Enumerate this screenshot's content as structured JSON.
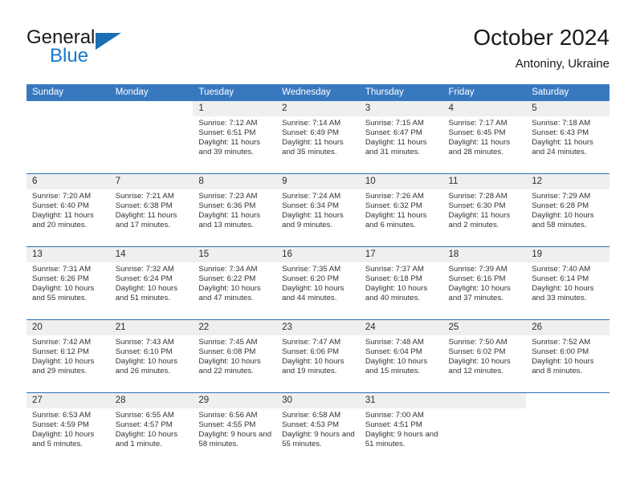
{
  "brand": {
    "name_line1": "General",
    "name_line2": "Blue",
    "triangle_icon": "triangle-icon",
    "color_dark": "#1a1a1a",
    "color_blue": "#1877c9"
  },
  "header": {
    "title": "October 2024",
    "subtitle": "Antoniny, Ukraine"
  },
  "theme": {
    "header_blue": "#3878bf",
    "divider_blue": "#2c6fb2",
    "daynum_band": "#efefef",
    "text": "#333333"
  },
  "weekdays": [
    "Sunday",
    "Monday",
    "Tuesday",
    "Wednesday",
    "Thursday",
    "Friday",
    "Saturday"
  ],
  "weeks": [
    {
      "days": [
        {
          "number": "",
          "detail": "",
          "empty": true
        },
        {
          "number": "",
          "detail": "",
          "empty": true
        },
        {
          "number": "1",
          "detail": "Sunrise: 7:12 AM\nSunset: 6:51 PM\nDaylight: 11 hours and 39 minutes."
        },
        {
          "number": "2",
          "detail": "Sunrise: 7:14 AM\nSunset: 6:49 PM\nDaylight: 11 hours and 35 minutes."
        },
        {
          "number": "3",
          "detail": "Sunrise: 7:15 AM\nSunset: 6:47 PM\nDaylight: 11 hours and 31 minutes."
        },
        {
          "number": "4",
          "detail": "Sunrise: 7:17 AM\nSunset: 6:45 PM\nDaylight: 11 hours and 28 minutes."
        },
        {
          "number": "5",
          "detail": "Sunrise: 7:18 AM\nSunset: 6:43 PM\nDaylight: 11 hours and 24 minutes."
        }
      ],
      "band_start_col": 2,
      "band_end_col": 7
    },
    {
      "days": [
        {
          "number": "6",
          "detail": "Sunrise: 7:20 AM\nSunset: 6:40 PM\nDaylight: 11 hours and 20 minutes."
        },
        {
          "number": "7",
          "detail": "Sunrise: 7:21 AM\nSunset: 6:38 PM\nDaylight: 11 hours and 17 minutes."
        },
        {
          "number": "8",
          "detail": "Sunrise: 7:23 AM\nSunset: 6:36 PM\nDaylight: 11 hours and 13 minutes."
        },
        {
          "number": "9",
          "detail": "Sunrise: 7:24 AM\nSunset: 6:34 PM\nDaylight: 11 hours and 9 minutes."
        },
        {
          "number": "10",
          "detail": "Sunrise: 7:26 AM\nSunset: 6:32 PM\nDaylight: 11 hours and 6 minutes."
        },
        {
          "number": "11",
          "detail": "Sunrise: 7:28 AM\nSunset: 6:30 PM\nDaylight: 11 hours and 2 minutes."
        },
        {
          "number": "12",
          "detail": "Sunrise: 7:29 AM\nSunset: 6:28 PM\nDaylight: 10 hours and 58 minutes."
        }
      ],
      "band_start_col": 0,
      "band_end_col": 7
    },
    {
      "days": [
        {
          "number": "13",
          "detail": "Sunrise: 7:31 AM\nSunset: 6:26 PM\nDaylight: 10 hours and 55 minutes."
        },
        {
          "number": "14",
          "detail": "Sunrise: 7:32 AM\nSunset: 6:24 PM\nDaylight: 10 hours and 51 minutes."
        },
        {
          "number": "15",
          "detail": "Sunrise: 7:34 AM\nSunset: 6:22 PM\nDaylight: 10 hours and 47 minutes."
        },
        {
          "number": "16",
          "detail": "Sunrise: 7:35 AM\nSunset: 6:20 PM\nDaylight: 10 hours and 44 minutes."
        },
        {
          "number": "17",
          "detail": "Sunrise: 7:37 AM\nSunset: 6:18 PM\nDaylight: 10 hours and 40 minutes."
        },
        {
          "number": "18",
          "detail": "Sunrise: 7:39 AM\nSunset: 6:16 PM\nDaylight: 10 hours and 37 minutes."
        },
        {
          "number": "19",
          "detail": "Sunrise: 7:40 AM\nSunset: 6:14 PM\nDaylight: 10 hours and 33 minutes."
        }
      ],
      "band_start_col": 0,
      "band_end_col": 7
    },
    {
      "days": [
        {
          "number": "20",
          "detail": "Sunrise: 7:42 AM\nSunset: 6:12 PM\nDaylight: 10 hours and 29 minutes."
        },
        {
          "number": "21",
          "detail": "Sunrise: 7:43 AM\nSunset: 6:10 PM\nDaylight: 10 hours and 26 minutes."
        },
        {
          "number": "22",
          "detail": "Sunrise: 7:45 AM\nSunset: 6:08 PM\nDaylight: 10 hours and 22 minutes."
        },
        {
          "number": "23",
          "detail": "Sunrise: 7:47 AM\nSunset: 6:06 PM\nDaylight: 10 hours and 19 minutes."
        },
        {
          "number": "24",
          "detail": "Sunrise: 7:48 AM\nSunset: 6:04 PM\nDaylight: 10 hours and 15 minutes."
        },
        {
          "number": "25",
          "detail": "Sunrise: 7:50 AM\nSunset: 6:02 PM\nDaylight: 10 hours and 12 minutes."
        },
        {
          "number": "26",
          "detail": "Sunrise: 7:52 AM\nSunset: 6:00 PM\nDaylight: 10 hours and 8 minutes."
        }
      ],
      "band_start_col": 0,
      "band_end_col": 7
    },
    {
      "days": [
        {
          "number": "27",
          "detail": "Sunrise: 6:53 AM\nSunset: 4:59 PM\nDaylight: 10 hours and 5 minutes."
        },
        {
          "number": "28",
          "detail": "Sunrise: 6:55 AM\nSunset: 4:57 PM\nDaylight: 10 hours and 1 minute."
        },
        {
          "number": "29",
          "detail": "Sunrise: 6:56 AM\nSunset: 4:55 PM\nDaylight: 9 hours and 58 minutes."
        },
        {
          "number": "30",
          "detail": "Sunrise: 6:58 AM\nSunset: 4:53 PM\nDaylight: 9 hours and 55 minutes."
        },
        {
          "number": "31",
          "detail": "Sunrise: 7:00 AM\nSunset: 4:51 PM\nDaylight: 9 hours and 51 minutes."
        },
        {
          "number": "",
          "detail": "",
          "empty": true
        },
        {
          "number": "",
          "detail": "",
          "empty": true
        }
      ],
      "band_start_col": 0,
      "band_end_col": 6
    }
  ]
}
